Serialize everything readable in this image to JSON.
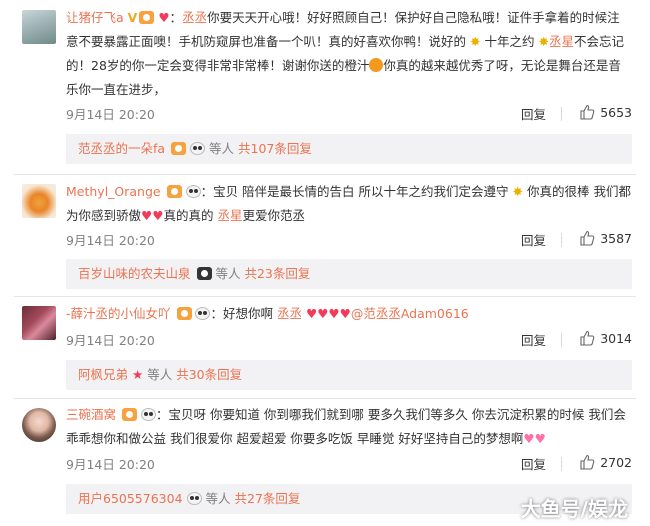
{
  "comments": [
    {
      "username": "让猪仔飞a",
      "mention": "丞丞",
      "text": "你要天天开心哦！好好照顾自己！保护好自己隐私哦！证件手拿着的时候注意不要暴露正面噢！手机防窥屏也准备一个叭！真的好喜欢你鸭！说好的",
      "text_b": "十年之约",
      "mention_b": "丞星",
      "text_c": "不会忘记的！28岁的你一定会变得非常非常棒！谢谢你送的橙汁",
      "text_d": "你真的越来越优秀了呀，无论是舞台还是音乐你一直在进步，",
      "time": "9月14日 20:20",
      "reply_label": "回复",
      "likes": "5653",
      "sub_user": "范丞丞的一朵fa",
      "sub_middle": "等人",
      "sub_total": "共107条回复"
    },
    {
      "username": "Methyl_Orange",
      "text": "：宝贝 陪伴是最长情的告白 所以十年之约我们定会遵守",
      "text_b": "你真的很棒 我们都为你感到骄傲",
      "text_c": "真的真的",
      "mention": "丞星",
      "text_d": "更爱你范丞",
      "time": "9月14日 20:20",
      "reply_label": "回复",
      "likes": "3587",
      "sub_user": "百岁山味的农夫山泉",
      "sub_middle": "等人",
      "sub_total": "共23条回复"
    },
    {
      "username": "-薛汁丞的小仙女吖",
      "text": "：好想你啊",
      "mention": "丞丞",
      "at_user": "@范丞丞Adam0616",
      "time": "9月14日 20:20",
      "reply_label": "回复",
      "likes": "3014",
      "sub_user": "阿枫兄弟",
      "sub_middle": "等人",
      "sub_total": "共30条回复"
    },
    {
      "username": "三碗酒窝",
      "text": "：宝贝呀 你要知道 你到哪我们就到哪 要多久我们等多久 你去沉淀积累的时候 我们会乖乖想你和做公益 我们很爱你 超爱超爱 你要多吃饭 早睡觉 好好坚持自己的梦想啊",
      "time": "9月14日 20:20",
      "reply_label": "回复",
      "likes": "2702",
      "sub_user": "用户6505576304",
      "sub_middle": "等人",
      "sub_total": "共27条回复"
    }
  ],
  "watermark": "大鱼号/娱龙"
}
